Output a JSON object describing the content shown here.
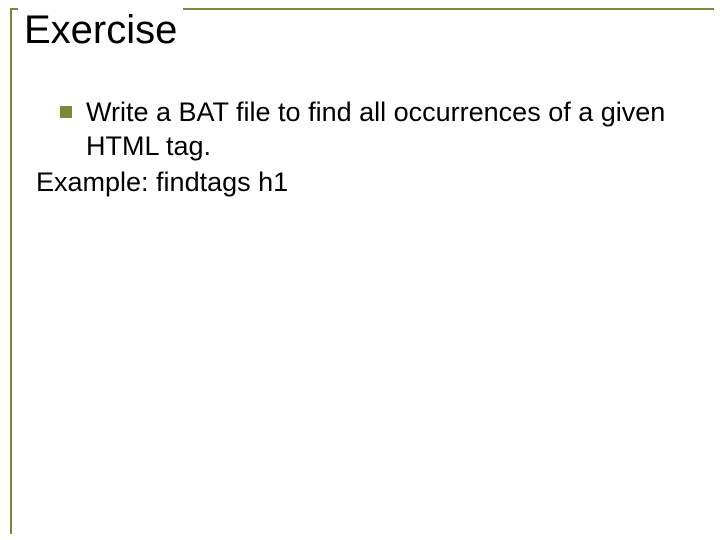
{
  "slide": {
    "title": "Exercise",
    "bullets": [
      {
        "text": "Write a BAT file to find all occurrences of a given HTML tag."
      }
    ],
    "example_line": "Example: findtags  h1"
  }
}
